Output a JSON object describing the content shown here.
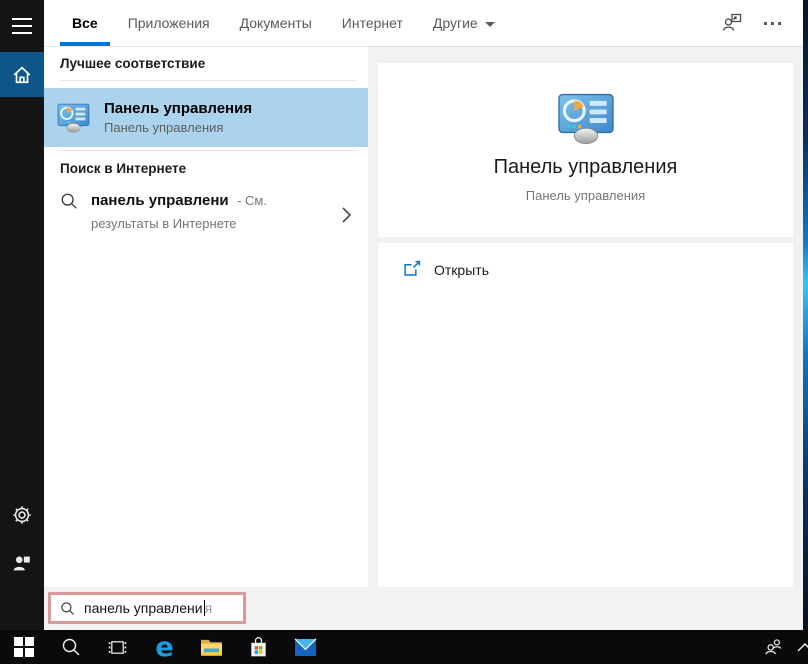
{
  "header": {
    "tabs": [
      {
        "label": "Все"
      },
      {
        "label": "Приложения"
      },
      {
        "label": "Документы"
      },
      {
        "label": "Интернет"
      },
      {
        "label": "Другие"
      }
    ]
  },
  "left_panel": {
    "best_match_header": "Лучшее соответствие",
    "best_match": {
      "title": "Панель управления",
      "subtitle": "Панель управления"
    },
    "web_header": "Поиск в Интернете",
    "web_suggestion": {
      "query": "панель управлени",
      "suffix": "- См.",
      "line2": "результаты в Интернете"
    }
  },
  "preview": {
    "title": "Панель управления",
    "subtitle": "Панель управления",
    "open_label": "Открыть"
  },
  "search_box": {
    "typed": "панель управлени",
    "suggestion": "я"
  },
  "colors": {
    "accent": "#0078d7",
    "selection_highlight": "#abd3ee",
    "annotation_border": "#d89a9a",
    "rail_home_background": "#0d5687"
  }
}
